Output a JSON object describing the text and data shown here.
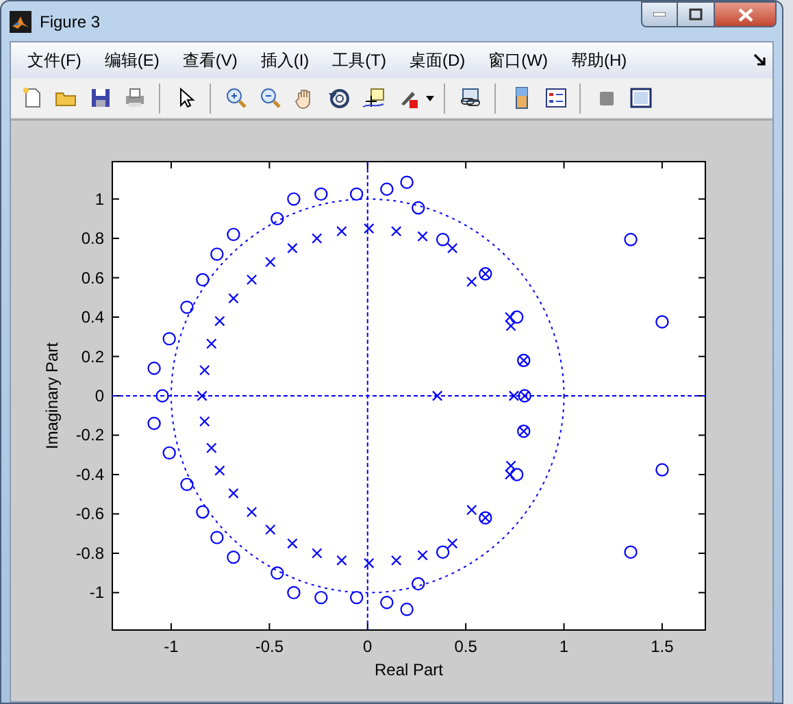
{
  "window": {
    "title": "Figure 3"
  },
  "menu": [
    "文件(F)",
    "编辑(E)",
    "查看(V)",
    "插入(I)",
    "工具(T)",
    "桌面(D)",
    "窗口(W)",
    "帮助(H)"
  ],
  "axes": {
    "chart_data": {
      "type": "scatter",
      "xlabel": "Real Part",
      "ylabel": "Imaginary Part",
      "xlim": [
        -1.3,
        1.72
      ],
      "ylim": [
        -1.19,
        1.19
      ],
      "xticks": [
        -1,
        -0.5,
        0,
        0.5,
        1,
        1.5
      ],
      "yticks": [
        -1,
        -0.8,
        -0.6,
        -0.4,
        -0.2,
        0,
        0.2,
        0.4,
        0.6,
        0.8,
        1
      ],
      "series": [
        {
          "color": "#0000ff",
          "marker": "o",
          "x": [
            -1.045,
            -1.087,
            -1.01,
            -0.92,
            -0.84,
            -0.767,
            -0.683,
            -0.46,
            -0.376,
            -0.237,
            -0.056,
            0.098,
            0.2,
            0.258,
            0.383,
            0.6,
            0.76,
            0.795,
            0.8,
            1.34,
            1.5,
            -1.087,
            -1.01,
            -0.92,
            -0.84,
            -0.767,
            -0.683,
            -0.46,
            -0.376,
            -0.237,
            -0.056,
            0.098,
            0.2,
            0.258,
            0.383,
            0.6,
            0.76,
            0.795,
            1.34,
            1.5
          ],
          "values": [
            0,
            0.14,
            0.29,
            0.45,
            0.59,
            0.72,
            0.82,
            0.9,
            1.0,
            1.025,
            1.025,
            1.05,
            1.085,
            0.955,
            0.794,
            0.62,
            0.4,
            0.18,
            0,
            0.794,
            0.376,
            -0.14,
            -0.29,
            -0.45,
            -0.59,
            -0.72,
            -0.82,
            -0.9,
            -1.0,
            -1.025,
            -1.025,
            -1.05,
            -1.085,
            -0.955,
            -0.794,
            -0.62,
            -0.4,
            -0.18,
            -0.794,
            -0.376
          ]
        },
        {
          "color": "#0000ff",
          "marker": "x",
          "x": [
            -0.843,
            -0.83,
            -0.795,
            -0.753,
            -0.683,
            -0.59,
            -0.495,
            -0.383,
            -0.258,
            -0.132,
            0.007,
            0.146,
            0.28,
            0.432,
            0.53,
            0.6,
            0.725,
            0.73,
            0.795,
            0.355,
            0.745,
            0.8,
            -0.83,
            -0.795,
            -0.753,
            -0.683,
            -0.59,
            -0.495,
            -0.383,
            -0.258,
            -0.132,
            0.007,
            0.146,
            0.28,
            0.432,
            0.53,
            0.6,
            0.725,
            0.73,
            0.795
          ],
          "values": [
            0,
            0.13,
            0.265,
            0.38,
            0.495,
            0.59,
            0.68,
            0.75,
            0.8,
            0.836,
            0.85,
            0.836,
            0.81,
            0.75,
            0.58,
            0.62,
            0.4,
            0.355,
            0.18,
            0,
            0,
            0,
            -0.13,
            -0.265,
            -0.38,
            -0.495,
            -0.59,
            -0.68,
            -0.75,
            -0.8,
            -0.836,
            -0.85,
            -0.836,
            -0.81,
            -0.75,
            -0.58,
            -0.62,
            -0.4,
            -0.355,
            -0.18
          ]
        }
      ]
    }
  }
}
